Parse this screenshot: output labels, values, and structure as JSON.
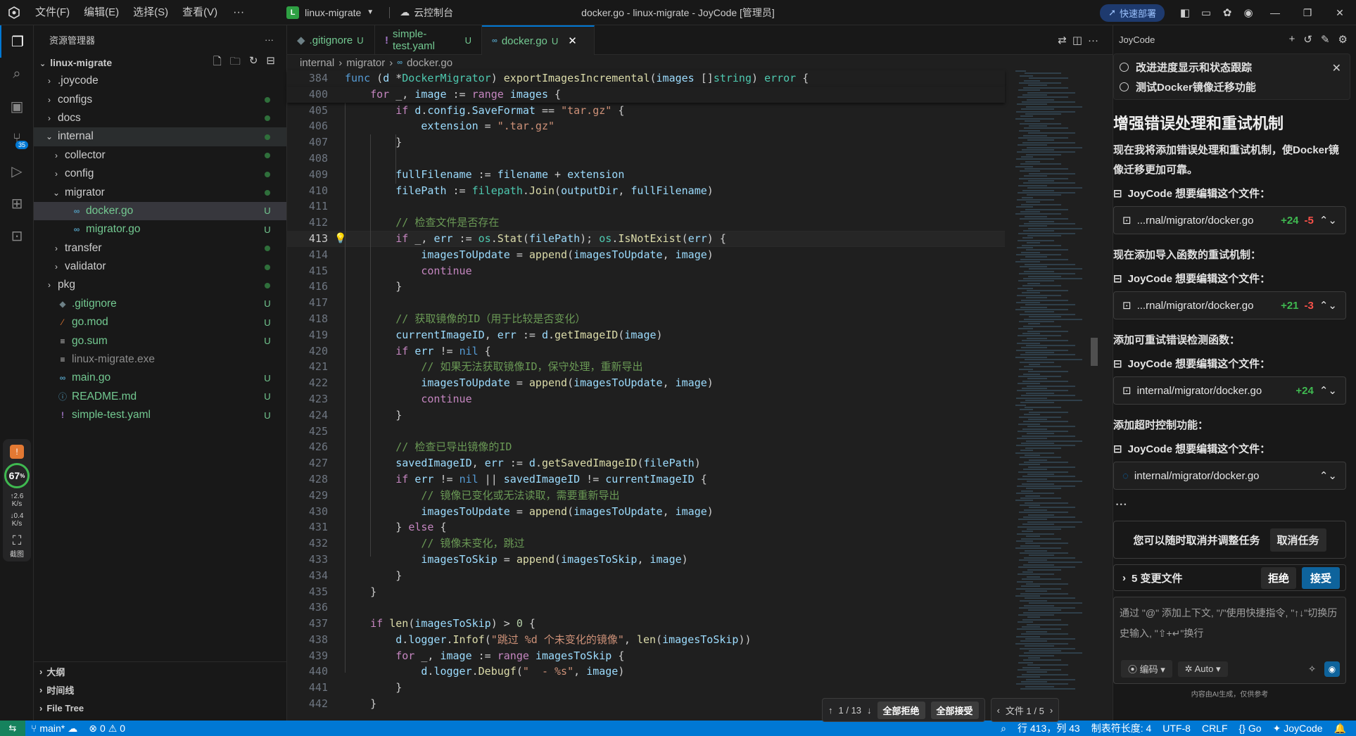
{
  "titlebar": {
    "menus": [
      "文件(F)",
      "编辑(E)",
      "选择(S)",
      "查看(V)"
    ],
    "more": "···",
    "project_badge": "L",
    "project": "linux-migrate",
    "cloud": "云控制台",
    "window_title": "docker.go - linux-migrate - JoyCode [管理员]",
    "deploy": "快速部署"
  },
  "activity": {
    "scm_badge": "35",
    "perf_percent": "67",
    "net_up": "2.6",
    "net_up_unit": "K/s",
    "net_down": "0.4",
    "net_down_unit": "K/s",
    "screenshot": "截图"
  },
  "explorer": {
    "title": "资源管理器",
    "root": "linux-migrate",
    "items": [
      {
        "label": ".joycode",
        "type": "folder",
        "indent": 1,
        "open": false
      },
      {
        "label": "configs",
        "type": "folder",
        "indent": 1,
        "open": false,
        "dot": true
      },
      {
        "label": "docs",
        "type": "folder",
        "indent": 1,
        "open": false,
        "dot": true
      },
      {
        "label": "internal",
        "type": "folder",
        "indent": 1,
        "open": true,
        "dot": true
      },
      {
        "label": "collector",
        "type": "folder",
        "indent": 2,
        "open": false,
        "dot": true
      },
      {
        "label": "config",
        "type": "folder",
        "indent": 2,
        "open": false,
        "dot": true
      },
      {
        "label": "migrator",
        "type": "folder",
        "indent": 2,
        "open": true,
        "dot": true
      },
      {
        "label": "docker.go",
        "type": "go",
        "indent": 3,
        "mark": "U",
        "selected": true
      },
      {
        "label": "migrator.go",
        "type": "go",
        "indent": 3,
        "mark": "U"
      },
      {
        "label": "transfer",
        "type": "folder",
        "indent": 2,
        "open": false,
        "dot": true
      },
      {
        "label": "validator",
        "type": "folder",
        "indent": 2,
        "open": false,
        "dot": true
      },
      {
        "label": "pkg",
        "type": "folder",
        "indent": 1,
        "open": false,
        "dot": true
      },
      {
        "label": ".gitignore",
        "type": "git",
        "indent": 1,
        "mark": "U"
      },
      {
        "label": "go.mod",
        "type": "rss",
        "indent": 1,
        "mark": "U"
      },
      {
        "label": "go.sum",
        "type": "sum",
        "indent": 1,
        "mark": "U"
      },
      {
        "label": "linux-migrate.exe",
        "type": "sum",
        "indent": 1,
        "gray": true
      },
      {
        "label": "main.go",
        "type": "go",
        "indent": 1,
        "mark": "U"
      },
      {
        "label": "README.md",
        "type": "info",
        "indent": 1,
        "mark": "U"
      },
      {
        "label": "simple-test.yaml",
        "type": "yaml",
        "indent": 1,
        "mark": "U"
      }
    ],
    "sections": [
      "大纲",
      "时间线",
      "File Tree"
    ]
  },
  "tabs": [
    {
      "label": ".gitignore",
      "mark": "U",
      "icon": "git"
    },
    {
      "label": "simple-test.yaml",
      "mark": "U",
      "icon": "yaml"
    },
    {
      "label": "docker.go",
      "mark": "U",
      "icon": "go",
      "active": true
    }
  ],
  "breadcrumb": [
    "internal",
    "migrator",
    "docker.go"
  ],
  "code": {
    "sticky": [
      {
        "n": "384",
        "html": "<span class='kw'>func</span> (<span class='vr'>d</span> *<span class='ty'>DockerMigrator</span>) <span class='fn'>exportImagesIncremental</span>(<span class='vr'>images</span> []<span class='ty'>string</span>) <span class='ty'>error</span> {"
      },
      {
        "n": "400",
        "html": "    <span class='kw2'>for</span> _, <span class='vr'>image</span> := <span class='kw2'>range</span> <span class='vr'>images</span> {"
      }
    ],
    "lines": [
      {
        "n": "405",
        "html": "        <span class='kw2'>if</span> <span class='vr'>d</span>.<span class='vr'>config</span>.<span class='vr'>SaveFormat</span> == <span class='str'>\"tar.gz\"</span> {"
      },
      {
        "n": "406",
        "html": "            <span class='vr'>extension</span> = <span class='str'>\".tar.gz\"</span>"
      },
      {
        "n": "407",
        "html": "        }"
      },
      {
        "n": "408",
        "html": ""
      },
      {
        "n": "409",
        "html": "        <span class='vr'>fullFilename</span> := <span class='vr'>filename</span> + <span class='vr'>extension</span>"
      },
      {
        "n": "410",
        "html": "        <span class='vr'>filePath</span> := <span class='ty'>filepath</span>.<span class='fn'>Join</span>(<span class='vr'>outputDir</span>, <span class='vr'>fullFilename</span>)"
      },
      {
        "n": "411",
        "html": ""
      },
      {
        "n": "412",
        "html": "        <span class='cm'>// 检查文件是否存在</span>"
      },
      {
        "n": "413",
        "html": "        <span class='kw2'>if</span> _, <span class='vr'>err</span> := <span class='ty'>os</span>.<span class='fn'>Stat</span>(<span class='vr'>filePath</span>); <span class='ty'>os</span>.<span class='fn'>IsNotExist</span>(<span class='vr'>err</span>) {",
        "current": true
      },
      {
        "n": "414",
        "html": "            <span class='vr'>imagesToUpdate</span> = <span class='fn'>append</span>(<span class='vr'>imagesToUpdate</span>, <span class='vr'>image</span>)"
      },
      {
        "n": "415",
        "html": "            <span class='kw2'>continue</span>"
      },
      {
        "n": "416",
        "html": "        }"
      },
      {
        "n": "417",
        "html": ""
      },
      {
        "n": "418",
        "html": "        <span class='cm'>// 获取镜像的ID（用于比较是否变化）</span>"
      },
      {
        "n": "419",
        "html": "        <span class='vr'>currentImageID</span>, <span class='vr'>err</span> := <span class='vr'>d</span>.<span class='fn'>getImageID</span>(<span class='vr'>image</span>)"
      },
      {
        "n": "420",
        "html": "        <span class='kw2'>if</span> <span class='vr'>err</span> != <span class='kw'>nil</span> {"
      },
      {
        "n": "421",
        "html": "            <span class='cm'>// 如果无法获取镜像ID，保守处理，重新导出</span>"
      },
      {
        "n": "422",
        "html": "            <span class='vr'>imagesToUpdate</span> = <span class='fn'>append</span>(<span class='vr'>imagesToUpdate</span>, <span class='vr'>image</span>)"
      },
      {
        "n": "423",
        "html": "            <span class='kw2'>continue</span>"
      },
      {
        "n": "424",
        "html": "        }"
      },
      {
        "n": "425",
        "html": ""
      },
      {
        "n": "426",
        "html": "        <span class='cm'>// 检查已导出镜像的ID</span>"
      },
      {
        "n": "427",
        "html": "        <span class='vr'>savedImageID</span>, <span class='vr'>err</span> := <span class='vr'>d</span>.<span class='fn'>getSavedImageID</span>(<span class='vr'>filePath</span>)"
      },
      {
        "n": "428",
        "html": "        <span class='kw2'>if</span> <span class='vr'>err</span> != <span class='kw'>nil</span> || <span class='vr'>savedImageID</span> != <span class='vr'>currentImageID</span> {"
      },
      {
        "n": "429",
        "html": "            <span class='cm'>// 镜像已变化或无法读取，需要重新导出</span>"
      },
      {
        "n": "430",
        "html": "            <span class='vr'>imagesToUpdate</span> = <span class='fn'>append</span>(<span class='vr'>imagesToUpdate</span>, <span class='vr'>image</span>)"
      },
      {
        "n": "431",
        "html": "        } <span class='kw2'>else</span> {"
      },
      {
        "n": "432",
        "html": "            <span class='cm'>// 镜像未变化，跳过</span>"
      },
      {
        "n": "433",
        "html": "            <span class='vr'>imagesToSkip</span> = <span class='fn'>append</span>(<span class='vr'>imagesToSkip</span>, <span class='vr'>image</span>)"
      },
      {
        "n": "434",
        "html": "        }"
      },
      {
        "n": "435",
        "html": "    }"
      },
      {
        "n": "436",
        "html": ""
      },
      {
        "n": "437",
        "html": "    <span class='kw2'>if</span> <span class='fn'>len</span>(<span class='vr'>imagesToSkip</span>) > <span class='nm'>0</span> {"
      },
      {
        "n": "438",
        "html": "        <span class='vr'>d</span>.<span class='vr'>logger</span>.<span class='fn'>Infof</span>(<span class='str'>\"跳过 %d 个未变化的镜像\"</span>, <span class='fn'>len</span>(<span class='vr'>imagesToSkip</span>))"
      },
      {
        "n": "439",
        "html": "        <span class='kw2'>for</span> _, <span class='vr'>image</span> := <span class='kw2'>range</span> <span class='vr'>imagesToSkip</span> {"
      },
      {
        "n": "440",
        "html": "            <span class='vr'>d</span>.<span class='vr'>logger</span>.<span class='fn'>Debugf</span>(<span class='str'>\"  - %s\"</span>, <span class='vr'>image</span>)"
      },
      {
        "n": "441",
        "html": "        }"
      },
      {
        "n": "442",
        "html": "    }"
      }
    ]
  },
  "diffbar": {
    "pos": "1 / 13",
    "reject_all": "全部拒绝",
    "accept_all": "全部接受",
    "file_pos": "文件 1 / 5"
  },
  "chat": {
    "title": "JoyCode",
    "todos": [
      "改进进度显示和状态跟踪",
      "测试Docker镜像迁移功能"
    ],
    "heading": "增强错误处理和重试机制",
    "intro": "现在我将添加错误处理和重试机制，使Docker镜像迁移更加可靠。",
    "edit_note": "JoyCode 想要编辑这个文件：",
    "blocks": [
      {
        "pre": "",
        "file": "...rnal/migrator/docker.go",
        "add": "+24",
        "del": "-5"
      },
      {
        "pre": "现在添加导入函数的重试机制：",
        "file": "...rnal/migrator/docker.go",
        "add": "+21",
        "del": "-3"
      },
      {
        "pre": "添加可重试错误检测函数：",
        "file": "internal/migrator/docker.go",
        "add": "+24",
        "del": ""
      },
      {
        "pre": "添加超时控制功能：",
        "file": "internal/migrator/docker.go",
        "add": "",
        "del": ""
      }
    ],
    "loading": "• • •",
    "cancel_text": "您可以随时取消并调整任务",
    "cancel_btn": "取消任务",
    "changes": "5 变更文件",
    "reject": "拒绝",
    "accept": "接受",
    "input_placeholder": "通过 \"@\" 添加上下文, \"/\"使用快捷指令, \"↑↓\"切换历史输入, \"⇧+↵\"换行",
    "mode": "编码",
    "model": "Auto",
    "ai_note": "内容由AI生成，仅供参考"
  },
  "statusbar": {
    "branch": "main*",
    "errors": "0",
    "warnings": "0",
    "position": "行 413，列 43",
    "tabsize": "制表符长度: 4",
    "encoding": "UTF-8",
    "eol": "CRLF",
    "lang": "Go",
    "brand": "JoyCode"
  }
}
